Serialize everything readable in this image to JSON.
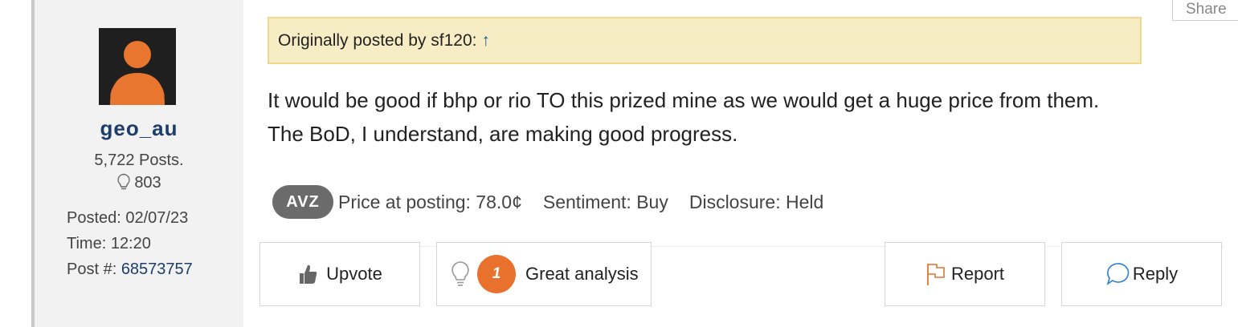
{
  "user": {
    "username": "geo_au",
    "posts": "5,722 Posts.",
    "likes": "803",
    "posted": "Posted: 02/07/23",
    "time": "Time: 12:20",
    "post_label": "Post #: ",
    "post_number": "68573757",
    "avatar_icon": "user-silhouette-icon"
  },
  "share_label": "Share",
  "quote": {
    "text": "Originally posted by sf120: ",
    "arrow": "↑"
  },
  "post_body": {
    "line1": "It would be good if bhp or rio TO this prized mine as we would get a huge price from them.",
    "line2": "The BoD, I understand, are making good progress."
  },
  "tags": {
    "ticker": "AVZ",
    "price": "Price at posting: 78.0¢",
    "sentiment": "Sentiment: Buy",
    "disclosure": "Disclosure: Held"
  },
  "actions": {
    "upvote": "Upvote",
    "analysis_count": "1",
    "analysis": "Great analysis",
    "report": "Report",
    "reply": "Reply"
  },
  "colors": {
    "accent_orange": "#e8722d",
    "link_blue": "#1d3d6b",
    "quote_bg": "#f7edc4",
    "sidebar_bg": "#f2f2f2"
  }
}
